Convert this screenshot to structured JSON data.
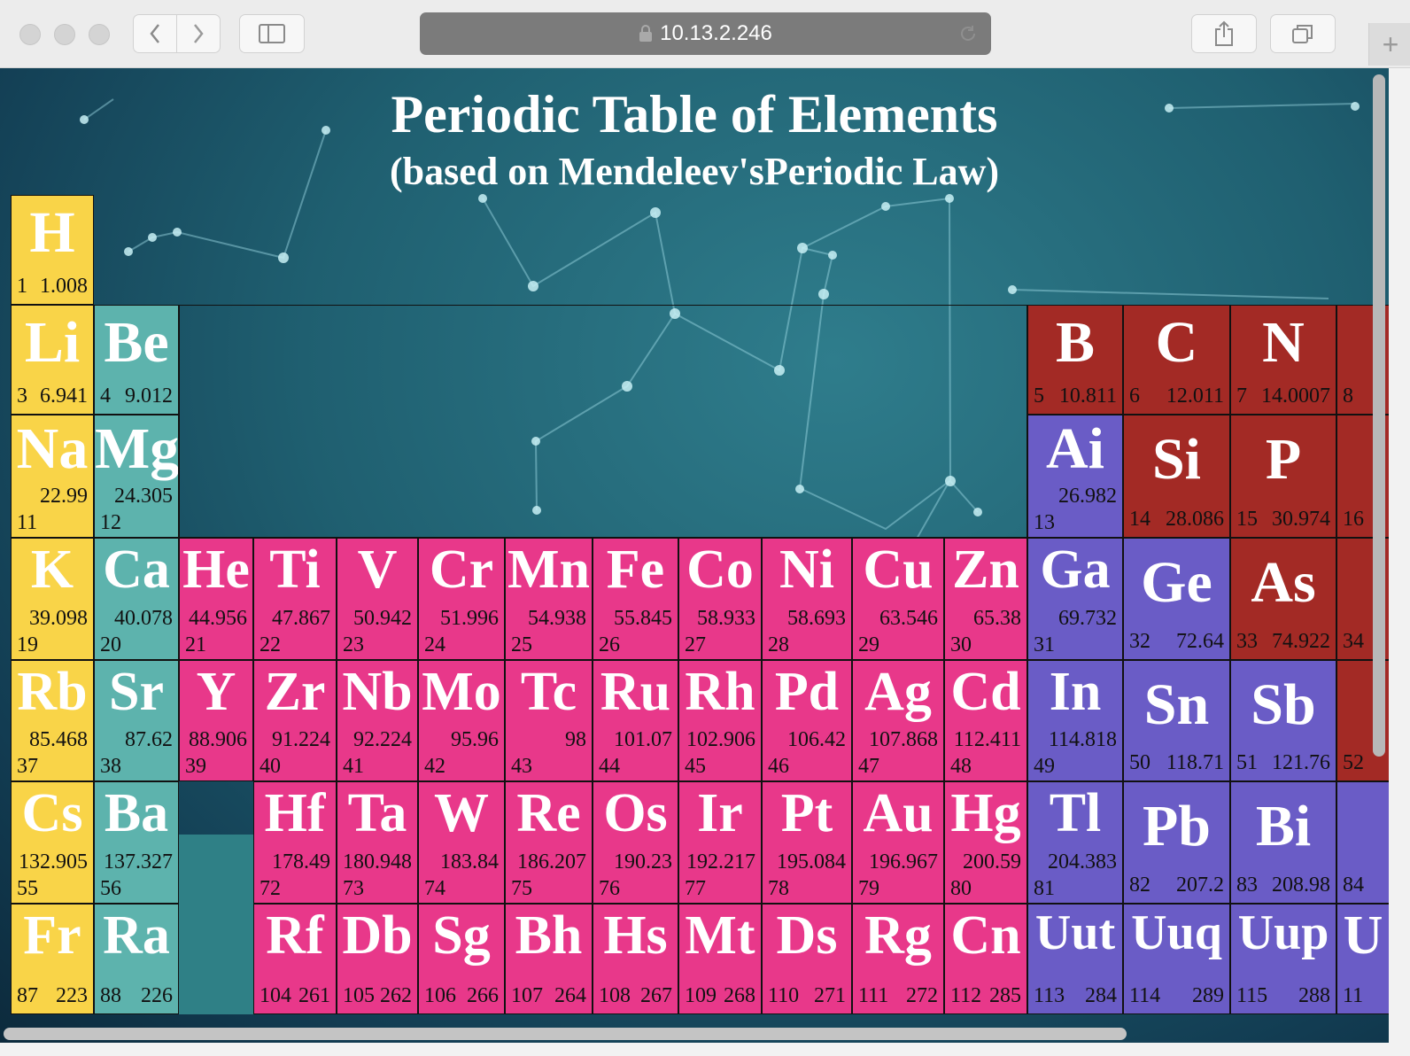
{
  "browser": {
    "url": "10.13.2.246",
    "back_icon": "chevron-left-icon",
    "forward_icon": "chevron-right-icon",
    "sidebar_icon": "sidebar-icon",
    "share_icon": "share-icon",
    "tabs_icon": "tabs-icon",
    "new_tab_icon": "plus-icon",
    "new_tab_glyph": "+"
  },
  "page": {
    "title": "Periodic Table of Elements",
    "subtitle": "(based on Mendeleev'sPeriodic Law)"
  },
  "colors": {
    "alkali": "#f9d448",
    "alkaline": "#5db3ad",
    "transition": "#e8388a",
    "nonmetal": "#a32a25",
    "post_transition": "#6a5cc6"
  },
  "elements": [
    {
      "symbol": "H",
      "number": "1",
      "mass": "1.008"
    },
    {
      "symbol": "Li",
      "number": "3",
      "mass": "6.941"
    },
    {
      "symbol": "Be",
      "number": "4",
      "mass": "9.012"
    },
    {
      "symbol": "B",
      "number": "5",
      "mass": "10.811"
    },
    {
      "symbol": "C",
      "number": "6",
      "mass": "12.011"
    },
    {
      "symbol": "N",
      "number": "7",
      "mass": "14.0007"
    },
    {
      "symbol": "",
      "number": "8",
      "mass": ""
    },
    {
      "symbol": "Na",
      "number": "11",
      "mass": "22.99"
    },
    {
      "symbol": "Mg",
      "number": "12",
      "mass": "24.305"
    },
    {
      "symbol": "Ai",
      "number": "13",
      "mass": "26.982"
    },
    {
      "symbol": "Si",
      "number": "14",
      "mass": "28.086"
    },
    {
      "symbol": "P",
      "number": "15",
      "mass": "30.974"
    },
    {
      "symbol": "",
      "number": "16",
      "mass": ""
    },
    {
      "symbol": "K",
      "number": "19",
      "mass": "39.098"
    },
    {
      "symbol": "Ca",
      "number": "20",
      "mass": "40.078"
    },
    {
      "symbol": "He",
      "number": "21",
      "mass": "44.956"
    },
    {
      "symbol": "Ti",
      "number": "22",
      "mass": "47.867"
    },
    {
      "symbol": "V",
      "number": "23",
      "mass": "50.942"
    },
    {
      "symbol": "Cr",
      "number": "24",
      "mass": "51.996"
    },
    {
      "symbol": "Mn",
      "number": "25",
      "mass": "54.938"
    },
    {
      "symbol": "Fe",
      "number": "26",
      "mass": "55.845"
    },
    {
      "symbol": "Co",
      "number": "27",
      "mass": "58.933"
    },
    {
      "symbol": "Ni",
      "number": "28",
      "mass": "58.693"
    },
    {
      "symbol": "Cu",
      "number": "29",
      "mass": "63.546"
    },
    {
      "symbol": "Zn",
      "number": "30",
      "mass": "65.38"
    },
    {
      "symbol": "Ga",
      "number": "31",
      "mass": "69.732"
    },
    {
      "symbol": "Ge",
      "number": "32",
      "mass": "72.64"
    },
    {
      "symbol": "As",
      "number": "33",
      "mass": "74.922"
    },
    {
      "symbol": "",
      "number": "34",
      "mass": ""
    },
    {
      "symbol": "Rb",
      "number": "37",
      "mass": "85.468"
    },
    {
      "symbol": "Sr",
      "number": "38",
      "mass": "87.62"
    },
    {
      "symbol": "Y",
      "number": "39",
      "mass": "88.906"
    },
    {
      "symbol": "Zr",
      "number": "40",
      "mass": "91.224"
    },
    {
      "symbol": "Nb",
      "number": "41",
      "mass": "92.224"
    },
    {
      "symbol": "Mo",
      "number": "42",
      "mass": "95.96"
    },
    {
      "symbol": "Tc",
      "number": "43",
      "mass": "98"
    },
    {
      "symbol": "Ru",
      "number": "44",
      "mass": "101.07"
    },
    {
      "symbol": "Rh",
      "number": "45",
      "mass": "102.906"
    },
    {
      "symbol": "Pd",
      "number": "46",
      "mass": "106.42"
    },
    {
      "symbol": "Ag",
      "number": "47",
      "mass": "107.868"
    },
    {
      "symbol": "Cd",
      "number": "48",
      "mass": "112.411"
    },
    {
      "symbol": "In",
      "number": "49",
      "mass": "114.818"
    },
    {
      "symbol": "Sn",
      "number": "50",
      "mass": "118.71"
    },
    {
      "symbol": "Sb",
      "number": "51",
      "mass": "121.76"
    },
    {
      "symbol": "",
      "number": "52",
      "mass": ""
    },
    {
      "symbol": "Cs",
      "number": "55",
      "mass": "132.905"
    },
    {
      "symbol": "Ba",
      "number": "56",
      "mass": "137.327"
    },
    {
      "symbol": "Hf",
      "number": "72",
      "mass": "178.49"
    },
    {
      "symbol": "Ta",
      "number": "73",
      "mass": "180.948"
    },
    {
      "symbol": "W",
      "number": "74",
      "mass": "183.84"
    },
    {
      "symbol": "Re",
      "number": "75",
      "mass": "186.207"
    },
    {
      "symbol": "Os",
      "number": "76",
      "mass": "190.23"
    },
    {
      "symbol": "Ir",
      "number": "77",
      "mass": "192.217"
    },
    {
      "symbol": "Pt",
      "number": "78",
      "mass": "195.084"
    },
    {
      "symbol": "Au",
      "number": "79",
      "mass": "196.967"
    },
    {
      "symbol": "Hg",
      "number": "80",
      "mass": "200.59"
    },
    {
      "symbol": "Tl",
      "number": "81",
      "mass": "204.383"
    },
    {
      "symbol": "Pb",
      "number": "82",
      "mass": "207.2"
    },
    {
      "symbol": "Bi",
      "number": "83",
      "mass": "208.98"
    },
    {
      "symbol": "",
      "number": "84",
      "mass": ""
    },
    {
      "symbol": "Fr",
      "number": "87",
      "mass": "223"
    },
    {
      "symbol": "Ra",
      "number": "88",
      "mass": "226"
    },
    {
      "symbol": "Rf",
      "number": "104",
      "mass": "261"
    },
    {
      "symbol": "Db",
      "number": "105",
      "mass": "262"
    },
    {
      "symbol": "Sg",
      "number": "106",
      "mass": "266"
    },
    {
      "symbol": "Bh",
      "number": "107",
      "mass": "264"
    },
    {
      "symbol": "Hs",
      "number": "108",
      "mass": "267"
    },
    {
      "symbol": "Mt",
      "number": "109",
      "mass": "268"
    },
    {
      "symbol": "Ds",
      "number": "110",
      "mass": "271"
    },
    {
      "symbol": "Rg",
      "number": "111",
      "mass": "272"
    },
    {
      "symbol": "Cn",
      "number": "112",
      "mass": "285"
    },
    {
      "symbol": "Uut",
      "number": "113",
      "mass": "284"
    },
    {
      "symbol": "Uuq",
      "number": "114",
      "mass": "289"
    },
    {
      "symbol": "Uup",
      "number": "115",
      "mass": "288"
    },
    {
      "symbol": "U",
      "number": "11",
      "mass": ""
    }
  ]
}
